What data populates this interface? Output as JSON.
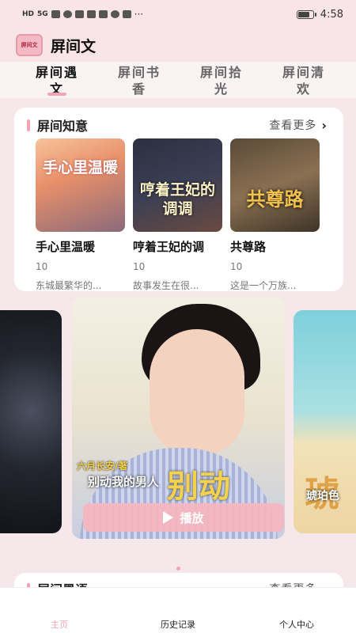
{
  "status_bar": {
    "network_label": "HD",
    "signal_label": "5G",
    "time": "4:58"
  },
  "app": {
    "logo_text": "屏间文",
    "title": "屏间文"
  },
  "tabs": [
    {
      "label": "屏间遇文",
      "active": true
    },
    {
      "label": "屏间书香",
      "active": false
    },
    {
      "label": "屏间拾光",
      "active": false
    },
    {
      "label": "屏间清欢",
      "active": false
    }
  ],
  "section": {
    "title": "屏间知意",
    "more_label": "查看更多",
    "books": [
      {
        "cover_text": "手心里温暖",
        "title": "手心里温暖",
        "count": "10",
        "desc": "东城最繁华的..."
      },
      {
        "cover_text": "哼着王妃的调调",
        "title": "哼着王妃的调",
        "count": "10",
        "desc": "故事发生在很..."
      },
      {
        "cover_text": "共尊路",
        "title": "共尊路",
        "count": "10",
        "desc": "这是一个万族..."
      }
    ]
  },
  "carousel": {
    "main": {
      "author": "六月长安/著",
      "cover_big_text": "别动",
      "title": "别动我的男人",
      "play_label": "播放"
    },
    "right": {
      "cover_big_text": "琥",
      "title": "琥珀色"
    }
  },
  "section2": {
    "title": "屏间墨语",
    "more_label": "查看更多"
  },
  "bottom_nav": [
    {
      "label": "主页",
      "active": true
    },
    {
      "label": "历史记录",
      "active": false
    },
    {
      "label": "个人中心",
      "active": false
    }
  ],
  "colors": {
    "accent": "#f3a3b2",
    "header_bg": "#f9e4e8"
  }
}
